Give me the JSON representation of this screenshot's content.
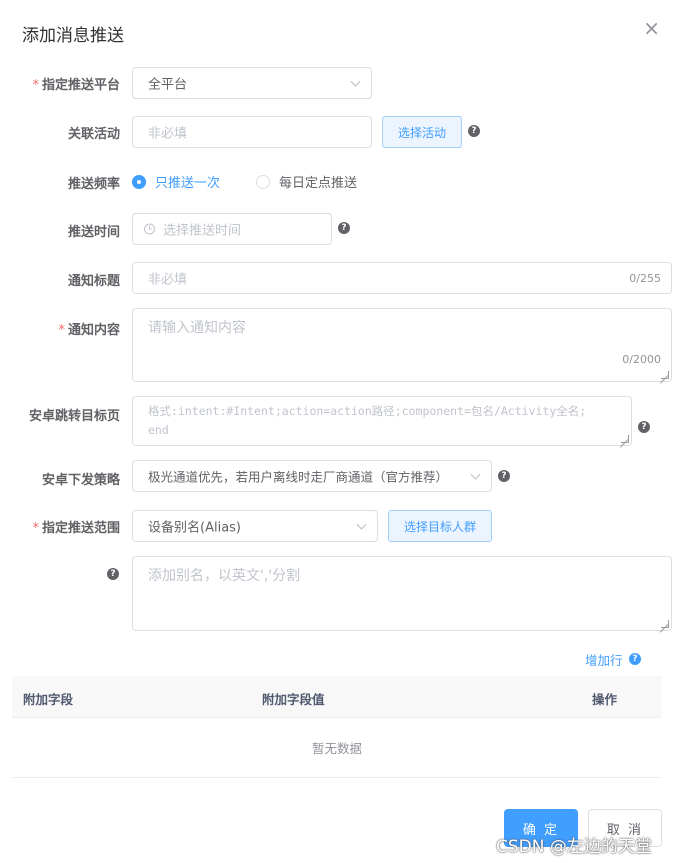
{
  "dialog": {
    "title": "添加消息推送",
    "close_icon": "close-icon"
  },
  "form": {
    "platform": {
      "label": "指定推送平台",
      "required": true,
      "value": "全平台"
    },
    "activity": {
      "label": "关联活动",
      "placeholder": "非必填",
      "button": "选择活动"
    },
    "frequency": {
      "label": "推送频率",
      "options": [
        "只推送一次",
        "每日定点推送"
      ],
      "selected": "只推送一次"
    },
    "push_time": {
      "label": "推送时间",
      "placeholder": "选择推送时间"
    },
    "notif_title": {
      "label": "通知标题",
      "placeholder": "非必填",
      "counter": "0/255"
    },
    "notif_content": {
      "label": "通知内容",
      "required": true,
      "placeholder": "请输入通知内容",
      "counter": "0/2000"
    },
    "android_target": {
      "label": "安卓跳转目标页",
      "placeholder_line1": "格式:intent:#Intent;action=action路径;component=包名/Activity全名;",
      "placeholder_line2": "end"
    },
    "android_strategy": {
      "label": "安卓下发策略",
      "value": "极光通道优先，若用户离线时走厂商通道（官方推荐）"
    },
    "scope": {
      "label": "指定推送范围",
      "required": true,
      "value": "设备别名(Alias)",
      "button": "选择目标人群"
    },
    "alias": {
      "placeholder": "添加别名，以英文','分割"
    },
    "add_row": "增加行"
  },
  "table": {
    "columns": [
      "附加字段",
      "附加字段值",
      "操作"
    ],
    "empty_text": "暂无数据"
  },
  "footer": {
    "confirm": "确 定",
    "cancel": "取 消"
  },
  "watermark": "CSDN @左边的天堂",
  "colors": {
    "primary": "#409eff",
    "required": "#f56c6c",
    "text": "#606266",
    "placeholder": "#c0c4cc"
  }
}
